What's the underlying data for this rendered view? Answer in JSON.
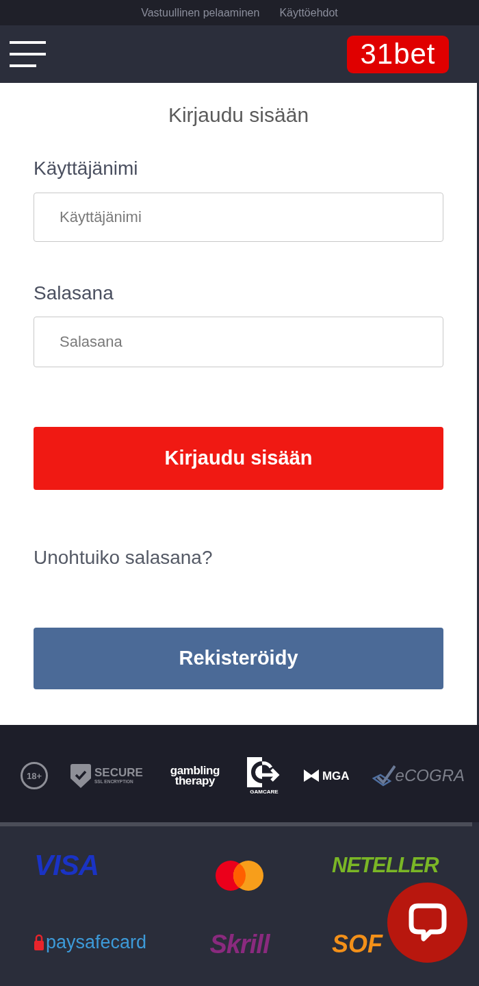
{
  "top_links": [
    "Vastuullinen pelaaminen",
    "Käyttöehdot"
  ],
  "header": {
    "logo": "31bet"
  },
  "login": {
    "title": "Kirjaudu sisään",
    "fields": [
      {
        "label": "Käyttäjänimi",
        "placeholder": "Käyttäjänimi"
      },
      {
        "label": "Salasana",
        "placeholder": "Salasana"
      }
    ],
    "submit": "Kirjaudu sisään",
    "forgot_link": "Unohtuiko salasana?",
    "register": "Rekisteröidy"
  },
  "trust_logos": [
    {
      "kind": "age",
      "text": "18+"
    },
    {
      "kind": "shield",
      "text": "SECURE",
      "subtext": "SSL ENCRYPTION"
    },
    {
      "kind": "wordmark",
      "text": "gambling therapy"
    },
    {
      "kind": "gamcare",
      "text": "GAMCARE"
    },
    {
      "kind": "mga",
      "text": "MGA"
    },
    {
      "kind": "tick",
      "text": "eCOGRA"
    }
  ],
  "payment_methods": [
    {
      "kind": "visa",
      "text": "VISA"
    },
    {
      "kind": "mastercard"
    },
    {
      "kind": "neteller",
      "text": "NETELLER"
    },
    {
      "kind": "paysafecard",
      "text": "paysafecard"
    },
    {
      "kind": "skrill",
      "text": "Skrill"
    },
    {
      "kind": "sofort",
      "text": "SOF"
    }
  ]
}
